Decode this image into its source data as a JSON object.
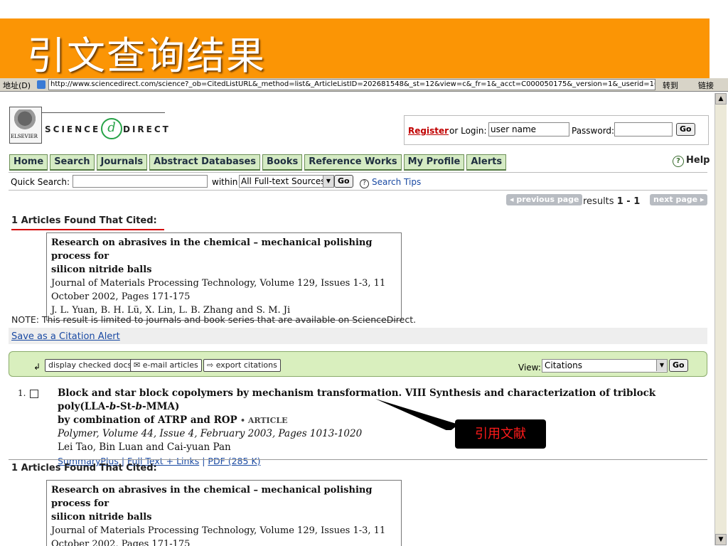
{
  "slide": {
    "title": "引文查询结果",
    "callout_label": "引用文献"
  },
  "browser": {
    "address_label": "地址(D)",
    "url": "http://www.sciencedirect.com/science?_ob=CitedListURL&_method=list&_ArticleListID=202681548&_st=12&view=c&_fr=1&_acct=C000050175&_version=1&_userid=166...",
    "go_label": "转到",
    "links_label": "链接"
  },
  "header": {
    "publisher": "ELSEVIER",
    "brand_left": "SCIENCE",
    "brand_mark": "d",
    "brand_right": "DIRECT",
    "register_label": "Register",
    "or_login_label": "or Login:",
    "username_value": "user name",
    "password_label": "Password:",
    "go_label": "Go"
  },
  "nav": {
    "items": [
      "Home",
      "Search",
      "Journals",
      "Abstract Databases",
      "Books",
      "Reference Works",
      "My Profile",
      "Alerts"
    ],
    "help_label": "Help"
  },
  "quick_search": {
    "label": "Quick Search:",
    "within_label": "within",
    "source_selected": "All Full-text Sources",
    "go_label": "Go",
    "tips_label": "Search Tips"
  },
  "pagination": {
    "prev_label": "◂ previous page",
    "results_prefix": "results",
    "results_range": "1 - 1",
    "next_label": "next page ▸"
  },
  "cited": {
    "found_label": "1 Articles Found That Cited:",
    "title_line1": "Research on abrasives in the chemical – mechanical polishing process for",
    "title_line2": "silicon nitride balls",
    "journal_line1": "Journal of Materials Processing Technology, Volume 129, Issues 1-3, 11",
    "journal_line2": "October 2002, Pages 171-175",
    "authors": "J. L. Yuan, B. H. Lü, X. Lin, L. B. Zhang and S. M. Ji"
  },
  "note": "NOTE: This result is limited to journals and book series that are available on ScienceDirect.",
  "save_alert_label": "Save as a Citation Alert",
  "toolbar": {
    "display_label": "display checked docs",
    "email_label": "e-mail articles",
    "export_label": "export citations",
    "view_label": "View:",
    "view_selected": "Citations",
    "go_label": "Go"
  },
  "article": {
    "number": "1.",
    "title_a": "Block and star block copolymers by mechanism transformation. VIII Synthesis and characterization of triblock poly(LLA-",
    "title_b": "b",
    "title_c": "-St-",
    "title_d": "b",
    "title_e": "-MMA)",
    "title_line2": "by combination of ATRP and ROP",
    "tag": "• ARTICLE",
    "journal": "Polymer, Volume 44, Issue 4, February 2003, Pages 1013-1020",
    "authors": "Lei Tao, Bin Luan and Cai-yuan Pan",
    "links": [
      "SummaryPlus",
      "Full Text + Links",
      "PDF (285 K)"
    ],
    "link_sep": "|"
  },
  "colors": {
    "banner": "#fb9505",
    "link": "#1a4aa3",
    "nav_bg": "#d5ebc4",
    "toolbar_bg": "#d9efbe",
    "accent_red": "#d40000"
  }
}
